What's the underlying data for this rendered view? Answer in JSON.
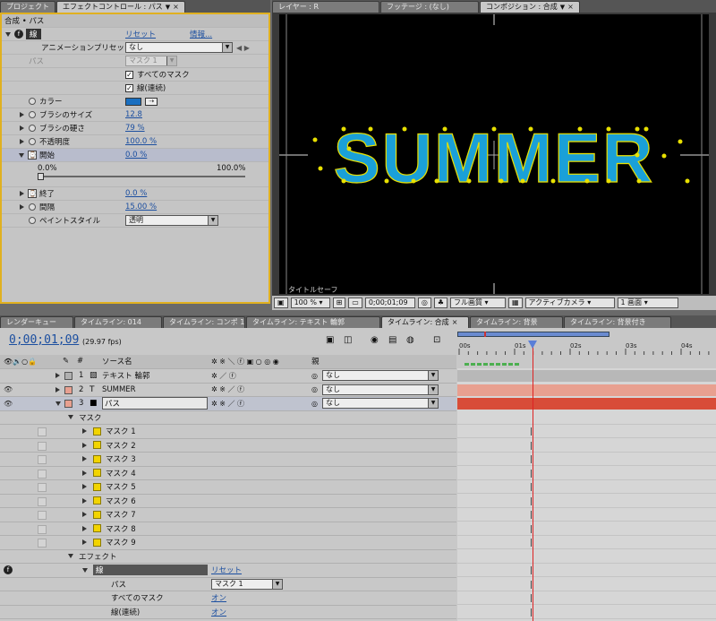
{
  "top_tabs_left": [
    {
      "label": "プロジェクト"
    },
    {
      "label": "エフェクトコントロール : パス"
    }
  ],
  "top_tabs_right": [
    {
      "label": "レイヤー : R"
    },
    {
      "label": "フッテージ : (なし)"
    },
    {
      "label": "コンポジション : 合成"
    }
  ],
  "effect": {
    "breadcrumb": "合成 • パス",
    "name": "線",
    "reset": "リセット",
    "info": "情報...",
    "preset_label": "アニメーションプリセット :",
    "preset_value": "なし",
    "path_label": "パス",
    "path_value": "マスク 1",
    "all_masks": "すべてのマスク",
    "stroke_seq": "線(連続)",
    "color_label": "カラー",
    "color_value": "#1a6fc0",
    "brush_size_label": "ブラシのサイズ",
    "brush_size": "12.8",
    "brush_hard_label": "ブラシの硬さ",
    "brush_hard": "79 %",
    "opacity_label": "不透明度",
    "opacity": "100.0 %",
    "start_label": "開始",
    "start": "0.0 %",
    "slider_min": "0.0%",
    "slider_max": "100.0%",
    "slider_value": 0,
    "end_label": "終了",
    "end": "0.0 %",
    "spacing_label": "間隔",
    "spacing": "15.00 %",
    "paint_label": "ペイントスタイル",
    "paint_value": "透明"
  },
  "comp": {
    "text": "SUMMER",
    "title_safe": "タイトルセーフ",
    "zoom": "100 %",
    "timecode": "0;00;01;09",
    "quality": "フル画質",
    "camera": "アクティブカメラ",
    "views": "1 画面",
    "text_color": "#1aa0d8"
  },
  "timeline_tabs": [
    {
      "label": "レンダーキュー"
    },
    {
      "label": "タイムライン: 014"
    },
    {
      "label": "タイムライン: コンポ 1"
    },
    {
      "label": "タイムライン: テキスト 輪郭"
    },
    {
      "label": "タイムライン: 合成"
    },
    {
      "label": "タイムライン: 背景"
    },
    {
      "label": "タイムライン: 背景付き"
    }
  ],
  "timeline": {
    "timecode": "0;00;01;09",
    "fps": "(29.97 fps)",
    "col_hash": "#",
    "col_source": "ソース名",
    "col_parent": "親",
    "layers": [
      {
        "num": "1",
        "name": "テキスト 輪郭",
        "parent": "なし",
        "label_color": "#b0b0b0",
        "bar_color": "#b8b8b8"
      },
      {
        "num": "2",
        "name": "SUMMER",
        "parent": "なし",
        "label_color": "#e8a090",
        "bar_color": "#e8a090"
      },
      {
        "num": "3",
        "name": "パス",
        "parent": "なし",
        "label_color": "#e8a090",
        "bar_color": "#d84c38"
      }
    ],
    "mask_group": "マスク",
    "masks": [
      "マスク 1",
      "マスク 2",
      "マスク 3",
      "マスク 4",
      "マスク 5",
      "マスク 6",
      "マスク 7",
      "マスク 8",
      "マスク 9"
    ],
    "effect_group": "エフェクト",
    "effect_name": "線",
    "effect_reset": "リセット",
    "path_label": "パス",
    "path_value": "マスク 1",
    "all_masks_label": "すべてのマスク",
    "all_masks_value": "オン",
    "stroke_seq_label": "線(連続)",
    "stroke_seq_value": "オン",
    "ruler": [
      "00s",
      "01s",
      "02s",
      "03s",
      "04s"
    ]
  }
}
